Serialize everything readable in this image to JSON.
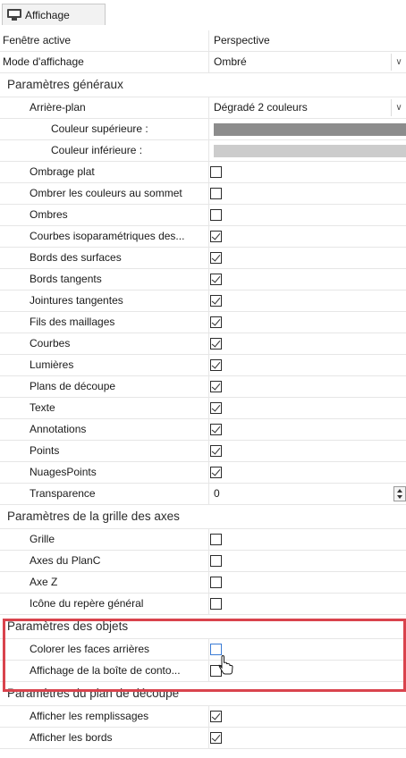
{
  "tab": {
    "icon": "monitor-icon",
    "label": "Affichage"
  },
  "rows": {
    "active_window": {
      "label": "Fenêtre active",
      "value": "Perspective"
    },
    "display_mode": {
      "label": "Mode d'affichage",
      "value": "Ombré"
    },
    "general": {
      "label": "Paramètres généraux"
    },
    "background": {
      "label": "Arrière-plan",
      "value": "Dégradé 2 couleurs"
    },
    "top_color": {
      "label": "Couleur supérieure :",
      "color": "#8c8c8c"
    },
    "bottom_color": {
      "label": "Couleur inférieure :",
      "color": "#cccccc"
    },
    "flat_shading": {
      "label": "Ombrage plat",
      "checked": false
    },
    "vertex_colors": {
      "label": "Ombrer les couleurs au sommet",
      "checked": false
    },
    "shadows": {
      "label": "Ombres",
      "checked": false
    },
    "iso_curves": {
      "label": "Courbes isoparamétriques des...",
      "checked": true
    },
    "surface_edges": {
      "label": "Bords des surfaces",
      "checked": true
    },
    "tangent_edges": {
      "label": "Bords tangents",
      "checked": true
    },
    "tangent_seams": {
      "label": "Jointures tangentes",
      "checked": true
    },
    "mesh_wires": {
      "label": "Fils des maillages",
      "checked": true
    },
    "curves": {
      "label": "Courbes",
      "checked": true
    },
    "lights": {
      "label": "Lumières",
      "checked": true
    },
    "clipping_planes": {
      "label": "Plans de découpe",
      "checked": true
    },
    "text": {
      "label": "Texte",
      "checked": true
    },
    "annotations": {
      "label": "Annotations",
      "checked": true
    },
    "points": {
      "label": "Points",
      "checked": true
    },
    "point_clouds": {
      "label": "NuagesPoints",
      "checked": true
    },
    "transparency": {
      "label": "Transparence",
      "value": "0"
    },
    "grid_section": {
      "label": "Paramètres de la grille des axes"
    },
    "grid": {
      "label": "Grille",
      "checked": false
    },
    "cplane_axes": {
      "label": "Axes du PlanC",
      "checked": false
    },
    "z_axis": {
      "label": "Axe Z",
      "checked": false
    },
    "world_axes_icon": {
      "label": "Icône du repère général",
      "checked": false
    },
    "objects_section": {
      "label": "Paramètres des objets"
    },
    "backface_color": {
      "label": "Colorer les faces arrières",
      "checked": false
    },
    "bbox_display": {
      "label": "Affichage de la boîte de conto...",
      "checked": false
    },
    "clipping_section": {
      "label": "Paramètres du plan de découpe"
    },
    "show_fills": {
      "label": "Afficher les remplissages",
      "checked": true
    },
    "show_edges": {
      "label": "Afficher les bords",
      "checked": true
    }
  },
  "colors": {
    "highlight": "#d9434d",
    "row_border": "#e6e6e6"
  }
}
